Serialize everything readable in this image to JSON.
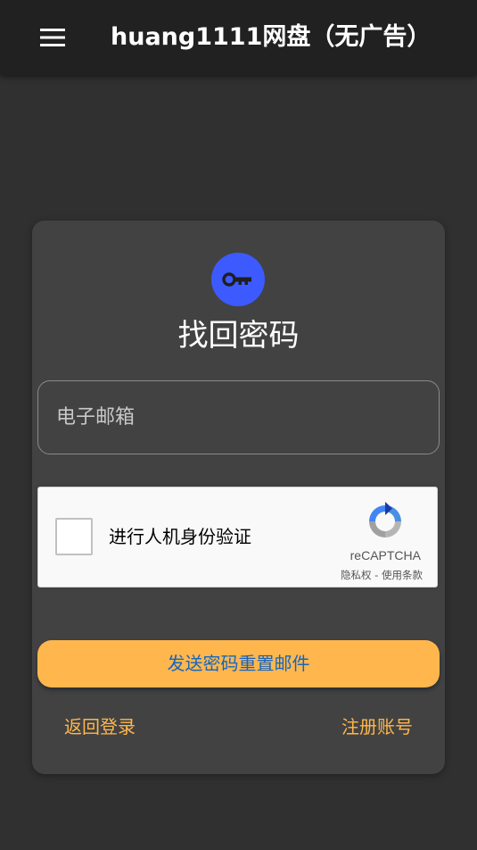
{
  "header": {
    "title": "huang1111网盘（无广告）",
    "menu_icon": "menu-icon"
  },
  "form": {
    "avatar_icon": "key-icon",
    "title": "找回密码",
    "email_placeholder": "电子邮箱",
    "recaptcha": {
      "label": "进行人机身份验证",
      "brand": "reCAPTCHA",
      "privacy": "隐私权",
      "separator": " - ",
      "terms": "使用条款"
    },
    "submit_label": "发送密码重置邮件",
    "back_login": "返回登录",
    "register": "注册账号"
  },
  "colors": {
    "appbar": "#212121",
    "background": "#303030",
    "card": "#424242",
    "accent": "#3d5afe",
    "button": "#ffb74d",
    "button_text": "#1565c0",
    "link": "#ffb74d"
  }
}
